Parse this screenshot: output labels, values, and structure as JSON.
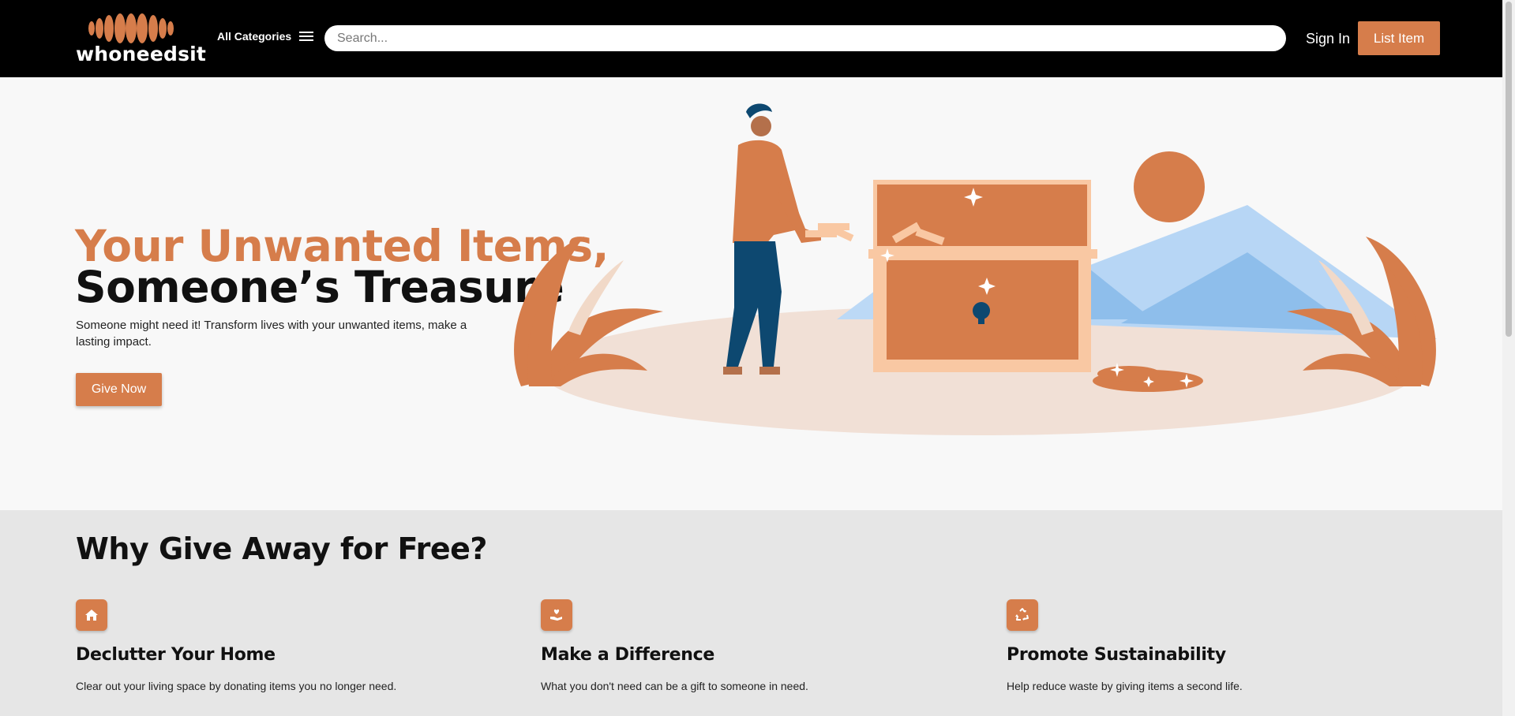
{
  "header": {
    "logo_text": "whoneedsit",
    "categories_label": "All Categories",
    "search_placeholder": "Search...",
    "signin_label": "Sign In",
    "list_item_label": "List Item"
  },
  "hero": {
    "title_line1": "Your Unwanted Items,",
    "title_line2": "Someone’s Treasure",
    "subtitle": "Someone might need it! Transform lives with your unwanted items, make a lasting impact.",
    "cta_label": "Give Now"
  },
  "why": {
    "title": "Why Give Away for Free?",
    "features": [
      {
        "icon": "home-icon",
        "title": "Declutter Your Home",
        "desc": "Clear out your living space by donating items you no longer need."
      },
      {
        "icon": "hand-heart-icon",
        "title": "Make a Difference",
        "desc": "What you don't need can be a gift to someone in need."
      },
      {
        "icon": "recycle-icon",
        "title": "Promote Sustainability",
        "desc": "Help reduce waste by giving items a second life."
      }
    ]
  },
  "colors": {
    "brand": "#d67d4b",
    "header_bg": "#000000",
    "section_bg": "#e6e6e6"
  }
}
